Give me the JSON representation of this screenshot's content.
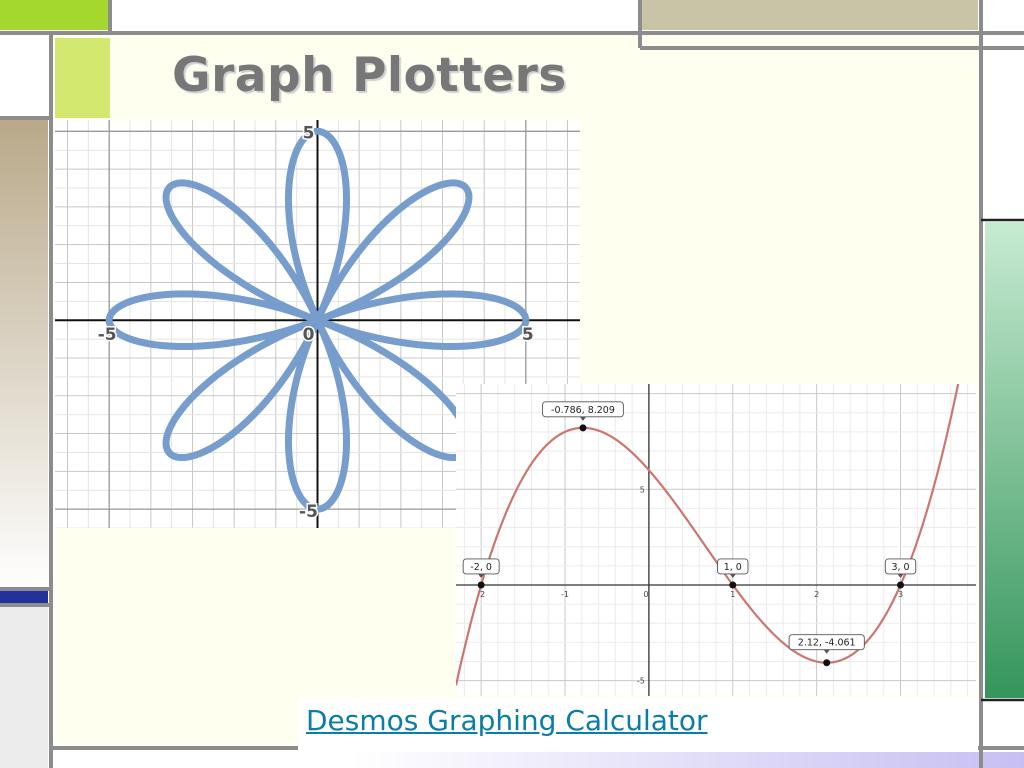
{
  "slide": {
    "title": "Graph Plotters",
    "link_text": "Desmos Graphing Calculator",
    "colors": {
      "rose_curve": "#779dcc",
      "cubic_curve": "#cd7670",
      "link": "#0a7da8",
      "title": "#777777",
      "lime_block": "#cde36a",
      "tan_block": "#c9c4a6",
      "green_bar": "#4fa36f",
      "navy_bar": "#23329a"
    }
  },
  "chart_data": [
    {
      "type": "line",
      "curve": "rose r = 5·cos(4θ)",
      "title": "",
      "xlabel": "",
      "ylabel": "",
      "xlim": [
        -6.3,
        6.3
      ],
      "ylim": [
        -5.5,
        5.3
      ],
      "grid": true,
      "tick_labels": {
        "x_neg": "-5",
        "origin": "0",
        "x_pos": "5",
        "y_pos": "5",
        "y_neg": "-5"
      }
    },
    {
      "type": "line",
      "curve": "y = (x+2)(x-1)(x-3)",
      "title": "",
      "xlabel": "",
      "ylabel": "",
      "xlim": [
        -2.3,
        3.9
      ],
      "ylim": [
        -5.8,
        10.5
      ],
      "grid": true,
      "x_ticks": [
        "-2",
        "-1",
        "0",
        "1",
        "2",
        "3"
      ],
      "y_ticks": [
        "5",
        "-5"
      ],
      "points": [
        {
          "x": -2,
          "y": 0,
          "label": "-2, 0"
        },
        {
          "x": -0.786,
          "y": 8.209,
          "label": "-0.786, 8.209"
        },
        {
          "x": 1,
          "y": 0,
          "label": "1, 0"
        },
        {
          "x": 3,
          "y": 0,
          "label": "3, 0"
        },
        {
          "x": 2.12,
          "y": -4.061,
          "label": "2.12, -4.061"
        }
      ]
    }
  ]
}
